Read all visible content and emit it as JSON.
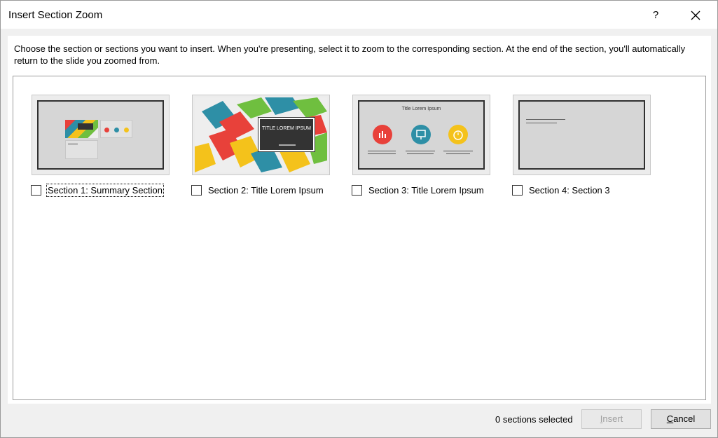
{
  "window": {
    "title": "Insert Section Zoom",
    "help_label": "?",
    "close_icon": "close-icon"
  },
  "instructions": "Choose the section or sections you want to insert. When you're presenting, select it to zoom to the corresponding section. At the end of the section, you'll automatically return to the slide you zoomed from.",
  "sections": [
    {
      "label": "Section 1: Summary Section",
      "checked": false,
      "focused": true
    },
    {
      "label": "Section 2: Title Lorem Ipsum",
      "checked": false,
      "focused": false
    },
    {
      "label": "Section 3: Title Lorem Ipsum",
      "checked": false,
      "focused": false
    },
    {
      "label": "Section 4: Section 3",
      "checked": false,
      "focused": false
    }
  ],
  "thumbnails": {
    "section2_title": "TITLE LOREM IPSUM",
    "section3_title": "Title Lorem Ipsum"
  },
  "footer": {
    "status": "0 sections selected",
    "insert_label": "Insert",
    "insert_underline": "I",
    "insert_rest": "nsert",
    "cancel_underline": "C",
    "cancel_rest": "ancel"
  },
  "colors": {
    "red": "#e8413a",
    "teal": "#2e8fa6",
    "yellow": "#f4c21b"
  }
}
